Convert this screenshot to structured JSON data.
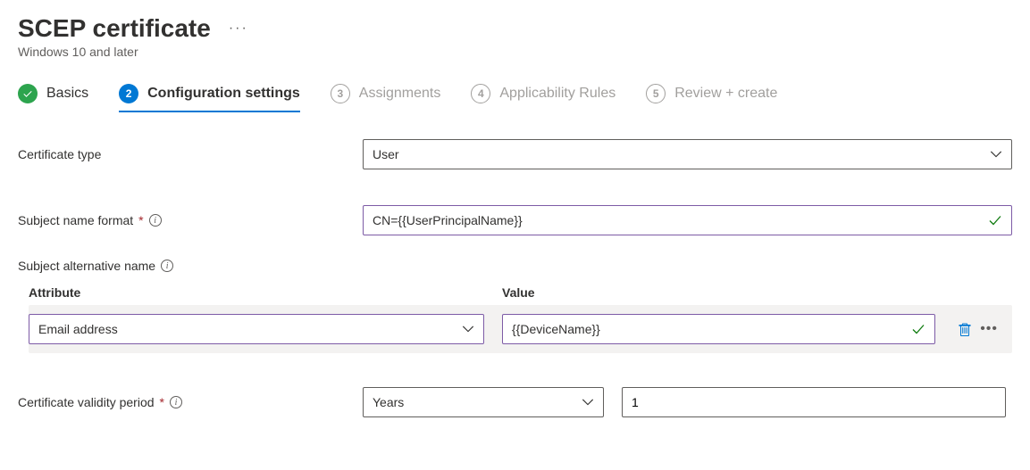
{
  "header": {
    "title": "SCEP certificate",
    "subtitle": "Windows 10 and later"
  },
  "tabs": [
    {
      "label": "Basics",
      "state": "done"
    },
    {
      "label": "Configuration settings",
      "state": "current",
      "num": "2"
    },
    {
      "label": "Assignments",
      "state": "pending",
      "num": "3"
    },
    {
      "label": "Applicability Rules",
      "state": "pending",
      "num": "4"
    },
    {
      "label": "Review + create",
      "state": "pending",
      "num": "5"
    }
  ],
  "form": {
    "certType": {
      "label": "Certificate type",
      "value": "User"
    },
    "subjectNameFormat": {
      "label": "Subject name format",
      "value": "CN={{UserPrincipalName}}"
    },
    "san": {
      "label": "Subject alternative name",
      "columns": {
        "attr": "Attribute",
        "val": "Value"
      },
      "rows": [
        {
          "attribute": "Email address",
          "value": "{{DeviceName}}"
        }
      ]
    },
    "validity": {
      "label": "Certificate validity period",
      "unit": "Years",
      "value": "1"
    }
  }
}
